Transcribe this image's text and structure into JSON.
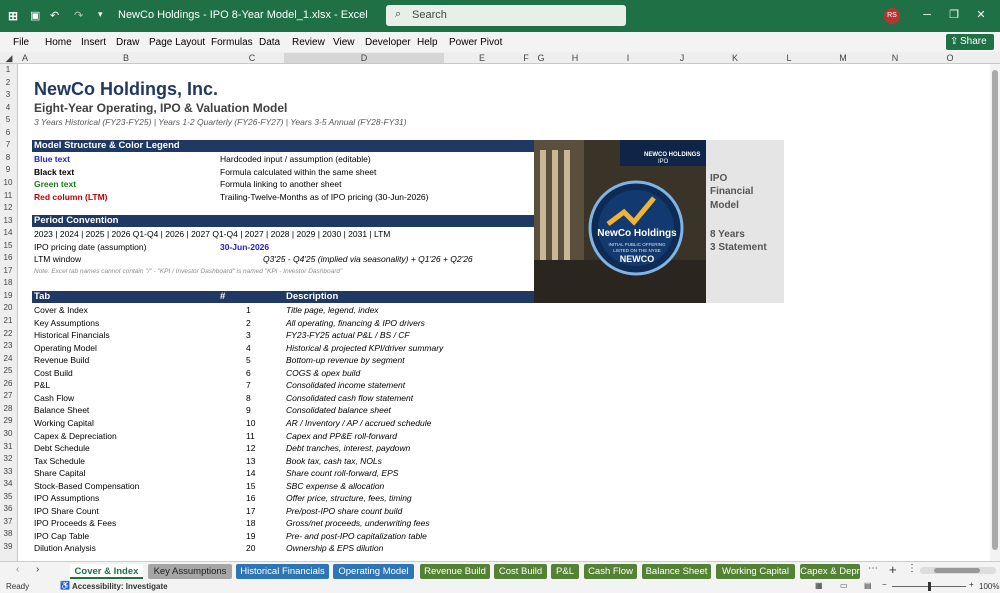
{
  "titlebar": {
    "doc_title": "NewCo Holdings - IPO 8-Year Model_1.xlsx  -  Excel",
    "search_placeholder": "Search",
    "avatar_initials": "RS"
  },
  "ribbon": {
    "menus": [
      "File",
      "Home",
      "Insert",
      "Draw",
      "Page Layout",
      "Formulas",
      "Data",
      "Review",
      "View",
      "Developer",
      "Help",
      "Power Pivot"
    ],
    "share_label": "Share"
  },
  "columns": [
    "A",
    "B",
    "C",
    "D",
    "E",
    "F",
    "G",
    "H",
    "I",
    "J",
    "K",
    "L",
    "M",
    "N",
    "O"
  ],
  "rows": [
    "1",
    "2",
    "3",
    "4",
    "5",
    "6",
    "7",
    "8",
    "9",
    "10",
    "11",
    "12",
    "13",
    "14",
    "15",
    "16",
    "17",
    "18",
    "19",
    "20",
    "21",
    "22",
    "23",
    "24",
    "25",
    "26",
    "27",
    "28",
    "29",
    "30",
    "31",
    "32",
    "33",
    "34",
    "35",
    "36",
    "37",
    "38",
    "39"
  ],
  "sheet": {
    "title": "NewCo Holdings, Inc.",
    "subtitle": "Eight-Year Operating, IPO & Valuation Model",
    "period_note": "3 Years Historical (FY23-FY25) | Years 1-2 Quarterly (FY26-FY27) | Years 3-5 Annual (FY28-FY31)",
    "legend_header": "Model Structure & Color Legend",
    "legend": [
      {
        "label": "Blue text",
        "desc": "Hardcoded input / assumption (editable)"
      },
      {
        "label": "Black text",
        "desc": "Formula calculated within the same sheet"
      },
      {
        "label": "Green text",
        "desc": "Formula linking to another sheet"
      },
      {
        "label": "Red column (LTM)",
        "desc": "Trailing-Twelve-Months as of IPO pricing (30-Jun-2026)"
      }
    ],
    "period_header": "Period Convention",
    "period_line": "2023 | 2024 | 2025 | 2026 Q1-Q4 | 2026 | 2027 Q1-Q4 | 2027 | 2028 | 2029 | 2030 | 2031 | LTM",
    "ipo_date_label": "IPO pricing date (assumption)",
    "ipo_date_value": "30-Jun-2026",
    "ltm_label": "LTM window",
    "ltm_value": "Q3'25 - Q4'25 (implied via seasonality) + Q1'26 + Q2'26",
    "footnote": "Note: Excel tab names cannot contain \"/\" - \"KPI / Investor Dashboard\" is named \"KPI - Investor Dashboard\"",
    "table_headers": {
      "tab": "Tab",
      "num": "#",
      "desc": "Description"
    },
    "table_rows": [
      {
        "tab": "Cover & Index",
        "num": "1",
        "desc": "Title page, legend, index"
      },
      {
        "tab": "Key Assumptions",
        "num": "2",
        "desc": "All operating, financing & IPO drivers"
      },
      {
        "tab": "Historical Financials",
        "num": "3",
        "desc": "FY23-FY25 actual P&L / BS / CF"
      },
      {
        "tab": "Operating Model",
        "num": "4",
        "desc": "Historical & projected KPI/driver summary"
      },
      {
        "tab": "Revenue Build",
        "num": "5",
        "desc": "Bottom-up revenue by segment"
      },
      {
        "tab": "Cost Build",
        "num": "6",
        "desc": "COGS & opex build"
      },
      {
        "tab": "P&L",
        "num": "7",
        "desc": "Consolidated income statement"
      },
      {
        "tab": "Cash Flow",
        "num": "8",
        "desc": "Consolidated cash flow statement"
      },
      {
        "tab": "Balance Sheet",
        "num": "9",
        "desc": "Consolidated balance sheet"
      },
      {
        "tab": "Working Capital",
        "num": "10",
        "desc": "AR / Inventory / AP / accrued schedule"
      },
      {
        "tab": "Capex & Depreciation",
        "num": "11",
        "desc": "Capex and PP&E roll-forward"
      },
      {
        "tab": "Debt Schedule",
        "num": "12",
        "desc": "Debt tranches, interest, paydown"
      },
      {
        "tab": "Tax Schedule",
        "num": "13",
        "desc": "Book tax, cash tax, NOLs"
      },
      {
        "tab": "Share Capital",
        "num": "14",
        "desc": "Share count roll-forward, EPS"
      },
      {
        "tab": "Stock-Based Compensation",
        "num": "15",
        "desc": "SBC expense & allocation"
      },
      {
        "tab": "IPO Assumptions",
        "num": "16",
        "desc": "Offer price, structure, fees, timing"
      },
      {
        "tab": "IPO Share Count",
        "num": "17",
        "desc": "Pre/post-IPO share count build"
      },
      {
        "tab": "IPO Proceeds & Fees",
        "num": "18",
        "desc": "Gross/net proceeds, underwriting fees"
      },
      {
        "tab": "IPO Cap Table",
        "num": "19",
        "desc": "Pre- and post-IPO capitalization table"
      },
      {
        "tab": "Dilution Analysis",
        "num": "20",
        "desc": "Ownership & EPS dilution"
      }
    ],
    "image": {
      "brand": "NewCo Holdings",
      "banner_top": "NEWCO HOLDINGS",
      "banner_sub": "IPO",
      "seal_line1": "INITIAL PUBLIC OFFERING",
      "seal_line2": "LISTED ON THE NYSE",
      "seal_ticker": "NEWCO",
      "side_line1": "IPO",
      "side_line2": "Financial",
      "side_line3": "Model",
      "side_line4": "8 Years",
      "side_line5": "3 Statement"
    }
  },
  "tabs": [
    {
      "label": "Cover & Index",
      "color": "#ffffff"
    },
    {
      "label": "Key Assumptions",
      "color": "#a6a6a6"
    },
    {
      "label": "Historical Financials",
      "color": "#2e75b6"
    },
    {
      "label": "Operating Model",
      "color": "#2e75b6"
    },
    {
      "label": "Revenue Build",
      "color": "#548235"
    },
    {
      "label": "Cost Build",
      "color": "#548235"
    },
    {
      "label": "P&L",
      "color": "#548235"
    },
    {
      "label": "Cash Flow",
      "color": "#548235"
    },
    {
      "label": "Balance Sheet",
      "color": "#548235"
    },
    {
      "label": "Working Capital",
      "color": "#548235"
    },
    {
      "label": "Capex & Depr",
      "color": "#548235"
    }
  ],
  "status": {
    "ready": "Ready",
    "accessibility": "Accessibility: Investigate",
    "zoom": "100%"
  }
}
